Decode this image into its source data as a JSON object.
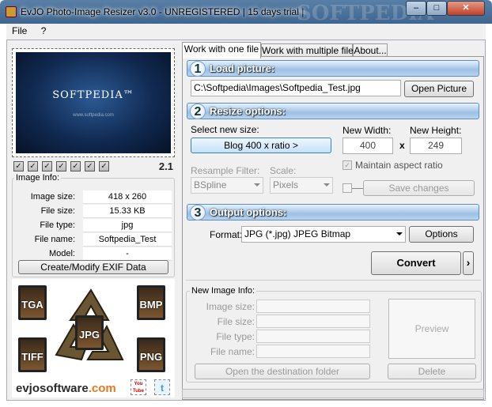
{
  "window": {
    "title": "EvJO Photo-Image Resizer v3.0 - UNREGISTERED  | 15 days trial |",
    "watermark": "SOFTPEDIA"
  },
  "menu": {
    "file": "File",
    "help": "?"
  },
  "left": {
    "version": "2.1",
    "preview_logo": "SOFTPEDIA™",
    "preview_url": "www.softpedia.com",
    "info_group": "Image Info:",
    "info": [
      {
        "label": "Image size:",
        "value": "418 x 260"
      },
      {
        "label": "File size:",
        "value": "15.33 KB"
      },
      {
        "label": "File type:",
        "value": "jpg"
      },
      {
        "label": "File name:",
        "value": "Softpedia_Test"
      },
      {
        "label": "Model:",
        "value": "-"
      }
    ],
    "exif_button": "Create/Modify EXIF Data",
    "formats": [
      "TGA",
      "BMP",
      "JPG",
      "TIFF",
      "PNG"
    ],
    "brand_main": "evjosoftware",
    "brand_tld": ".com",
    "youtube": "You Tube",
    "twitter": "t"
  },
  "tabs": [
    "Work with one file",
    "Work with multiple files",
    "About..."
  ],
  "load": {
    "num": "1",
    "title": "Load picture:",
    "path": "C:\\Softpedia\\Images\\Softpedia_Test.jpg",
    "open_button": "Open Picture"
  },
  "resize": {
    "num": "2",
    "title": "Resize options:",
    "select_label": "Select new size:",
    "size_button": "Blog 400 x ratio >",
    "width_label": "New Width:",
    "height_label": "New Height:",
    "width": "400",
    "times": "x",
    "height": "249",
    "aspect_label": "Maintain aspect ratio",
    "filter_label": "Resample Filter:",
    "filter_value": "BSpline",
    "scale_label": "Scale:",
    "scale_value": "Pixels",
    "save_button": "Save changes"
  },
  "output": {
    "num": "3",
    "title": "Output options:",
    "format_label": "Format:",
    "format_value": "JPG (*.jpg) JPEG Bitmap",
    "options_button": "Options",
    "convert_button": "Convert",
    "convert_arrow": "›"
  },
  "newinfo": {
    "group": "New Image Info:",
    "labels": [
      "Image size:",
      "File size:",
      "File type:",
      "File name:"
    ],
    "preview": "Preview",
    "open_folder": "Open the destination folder",
    "delete": "Delete"
  },
  "window_buttons": {
    "minimize": "–",
    "maximize": "□",
    "close": "✕"
  }
}
